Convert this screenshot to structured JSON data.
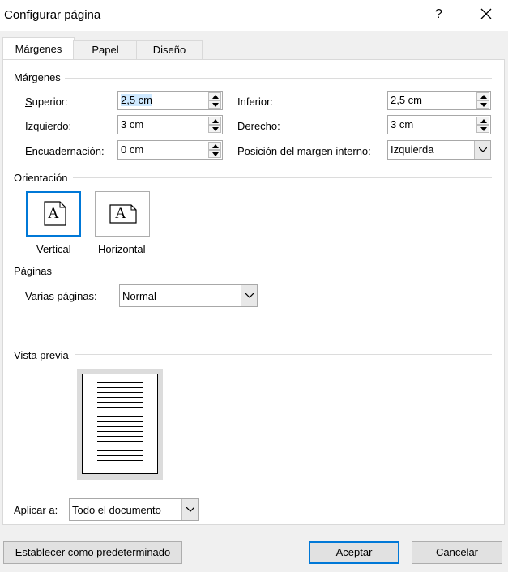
{
  "dialog": {
    "title": "Configurar página",
    "help_label": "?",
    "close_icon": "close-icon"
  },
  "tabs": [
    {
      "label": "Márgenes",
      "active": true
    },
    {
      "label": "Papel",
      "active": false
    },
    {
      "label": "Diseño",
      "active": false
    }
  ],
  "margins": {
    "section_title": "Márgenes",
    "top_label": "Superior:",
    "top_value": "2,5 cm",
    "bottom_label": "Inferior:",
    "bottom_value": "2,5 cm",
    "left_label": "Izquierdo:",
    "left_value": "3 cm",
    "right_label": "Derecho:",
    "right_value": "3 cm",
    "gutter_label": "Encuadernación:",
    "gutter_value": "0 cm",
    "gutter_pos_label": "Posición del margen interno:",
    "gutter_pos_value": "Izquierda"
  },
  "orientation": {
    "section_title": "Orientación",
    "portrait_label": "Vertical",
    "landscape_label": "Horizontal",
    "selected": "Vertical",
    "glyph": "A"
  },
  "pages": {
    "section_title": "Páginas",
    "multiple_label": "Varias páginas:",
    "multiple_value": "Normal"
  },
  "preview": {
    "section_title": "Vista previa"
  },
  "apply": {
    "label": "Aplicar a:",
    "value": "Todo el documento"
  },
  "buttons": {
    "set_default": "Establecer como predeterminado",
    "ok": "Aceptar",
    "cancel": "Cancelar"
  }
}
